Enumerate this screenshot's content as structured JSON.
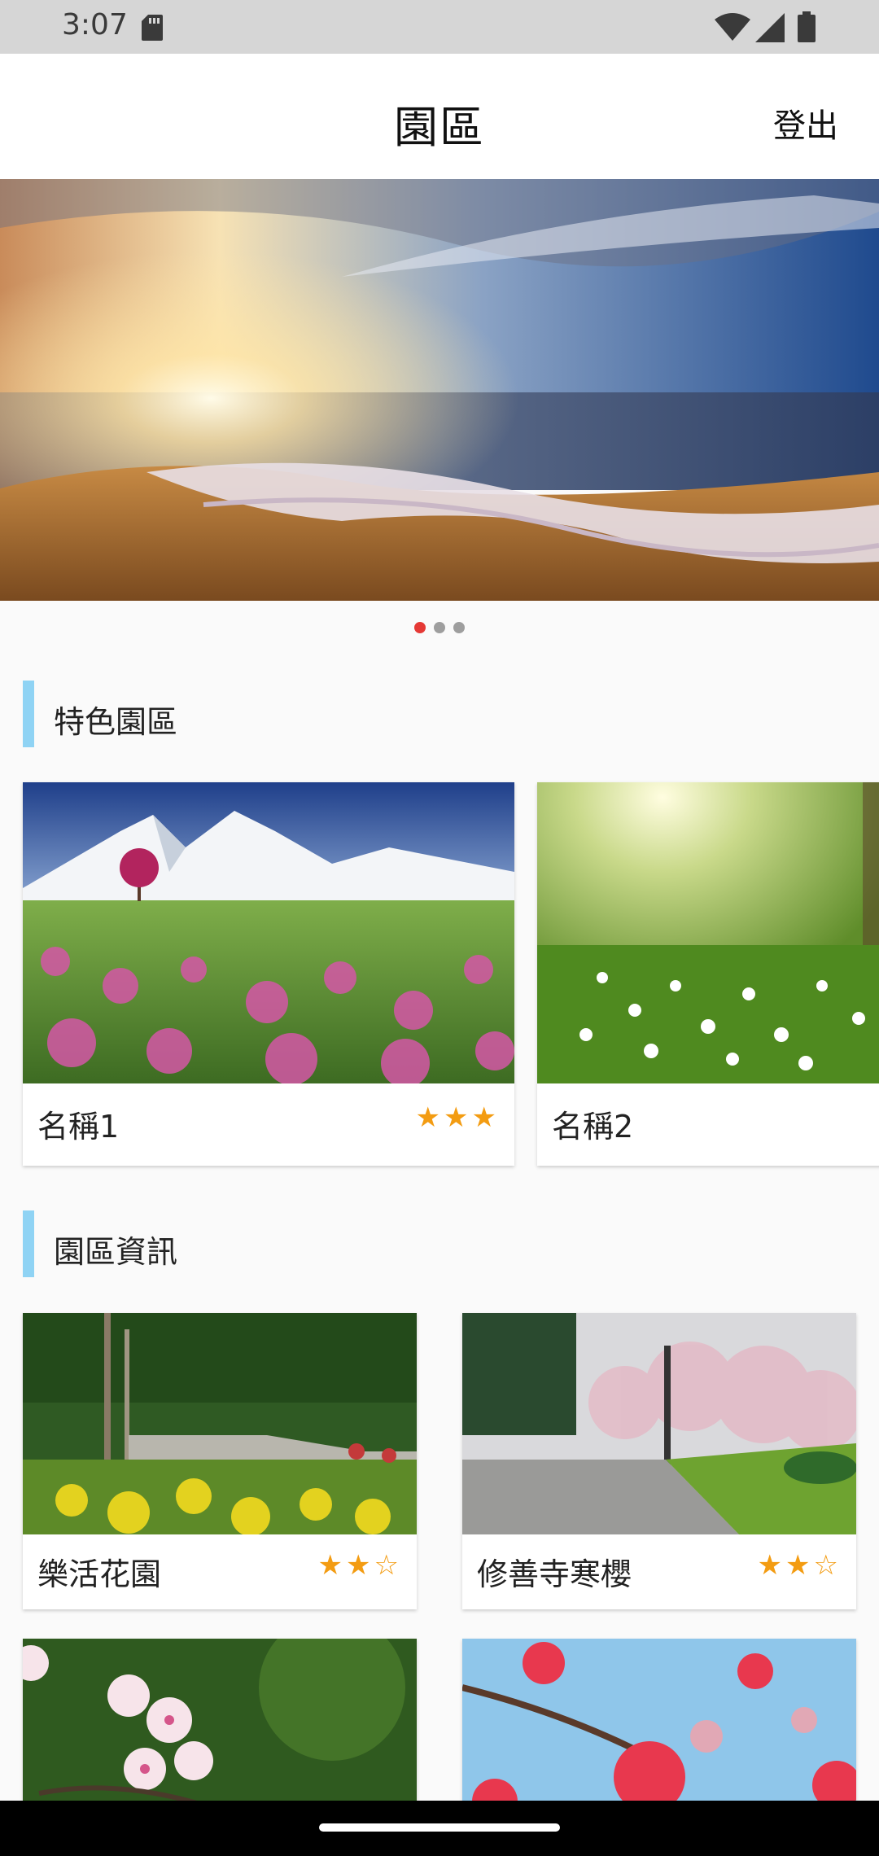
{
  "status_bar": {
    "time": "3:07",
    "icons": [
      "sd-card-icon",
      "wifi-icon",
      "cell-signal-icon",
      "battery-icon"
    ]
  },
  "header": {
    "title": "園區",
    "logout_label": "登出"
  },
  "banner": {
    "image": "sunset-beach-waves",
    "dots": 3,
    "active_dot": 0
  },
  "featured": {
    "section_title": "特色園區",
    "cards": [
      {
        "name": "名稱1",
        "stars": "★★★",
        "image": "snow-mountain-flower-field"
      },
      {
        "name": "名稱2",
        "image": "sunlit-meadow-daisies"
      }
    ]
  },
  "info": {
    "section_title": "園區資訊",
    "cards": [
      {
        "name": "樂活花園",
        "stars": "★★☆",
        "image": "garden-yellow-flowers"
      },
      {
        "name": "修善寺寒櫻",
        "stars": "★★☆",
        "image": "cherry-blossom-park-path"
      },
      {
        "image": "white-cherry-blossoms"
      },
      {
        "image": "pink-cherry-blossoms"
      }
    ]
  },
  "colors": {
    "accent_bar": "#8fd3f4",
    "star": "#f39c12",
    "active_dot": "#e53935"
  }
}
